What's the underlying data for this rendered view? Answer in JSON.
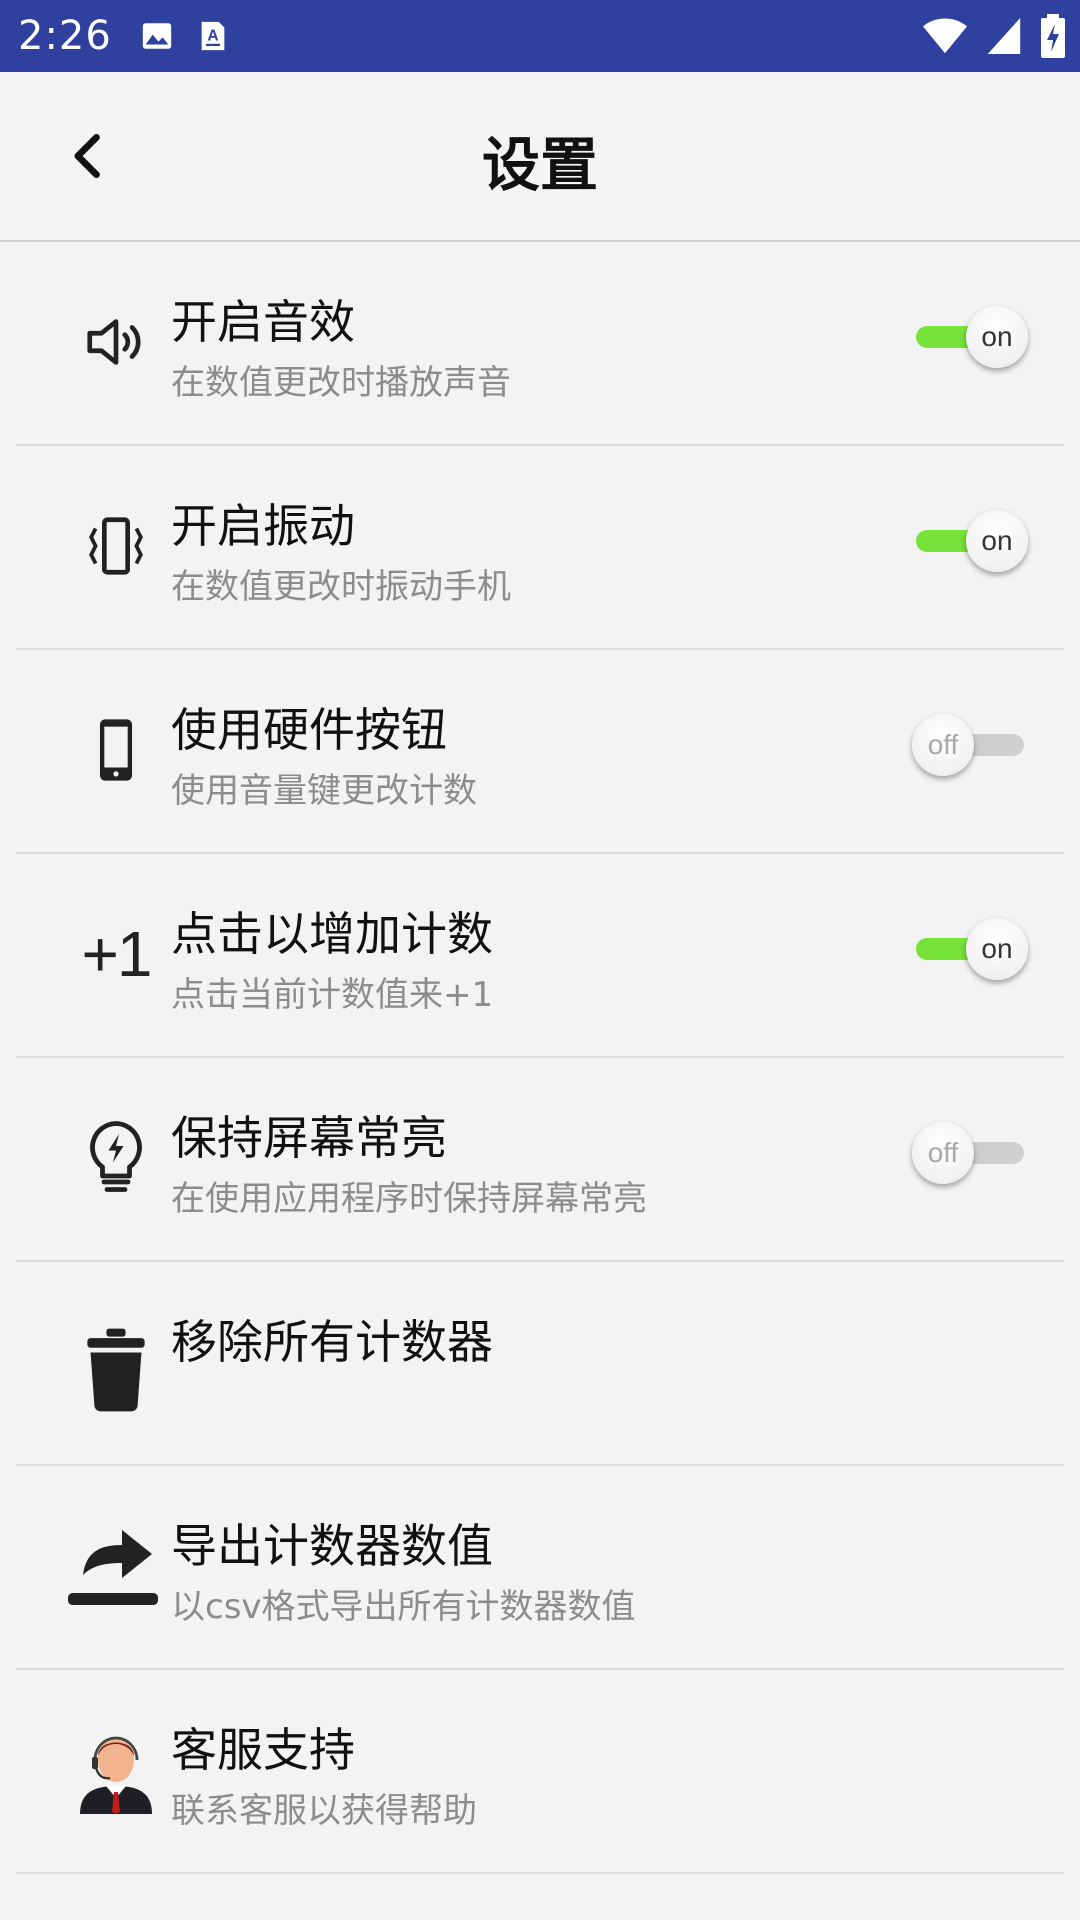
{
  "status_bar": {
    "time": "2:26",
    "icons": [
      "image-icon",
      "text-a-icon",
      "wifi-icon",
      "signal-icon",
      "battery-icon"
    ]
  },
  "toolbar": {
    "title": "设置",
    "back_icon": "chevron-left-icon"
  },
  "colors": {
    "status_bar": "#30409e",
    "toggle_on": "#77e23a",
    "toggle_off": "#cfcfcf"
  },
  "settings": [
    {
      "icon": "speaker-icon",
      "title": "开启音效",
      "subtitle": "在数值更改时播放声音",
      "toggle": "on"
    },
    {
      "icon": "vibrate-icon",
      "title": "开启振动",
      "subtitle": "在数值更改时振动手机",
      "toggle": "on"
    },
    {
      "icon": "phone-icon",
      "title": "使用硬件按钮",
      "subtitle": "使用音量键更改计数",
      "toggle": "off"
    },
    {
      "icon": "plus-one-icon",
      "icon_text": "+1",
      "title": "点击以增加计数",
      "subtitle": "点击当前计数值来+1",
      "toggle": "on"
    },
    {
      "icon": "lightbulb-icon",
      "title": "保持屏幕常亮",
      "subtitle": "在使用应用程序时保持屏幕常亮",
      "toggle": "off"
    },
    {
      "icon": "trash-icon",
      "title": "移除所有计数器",
      "subtitle": ""
    },
    {
      "icon": "share-export-icon",
      "title": "导出计数器数值",
      "subtitle": "以csv格式导出所有计数器数值"
    },
    {
      "icon": "customer-support-icon",
      "title": "客服支持",
      "subtitle": "联系客服以获得帮助"
    }
  ]
}
